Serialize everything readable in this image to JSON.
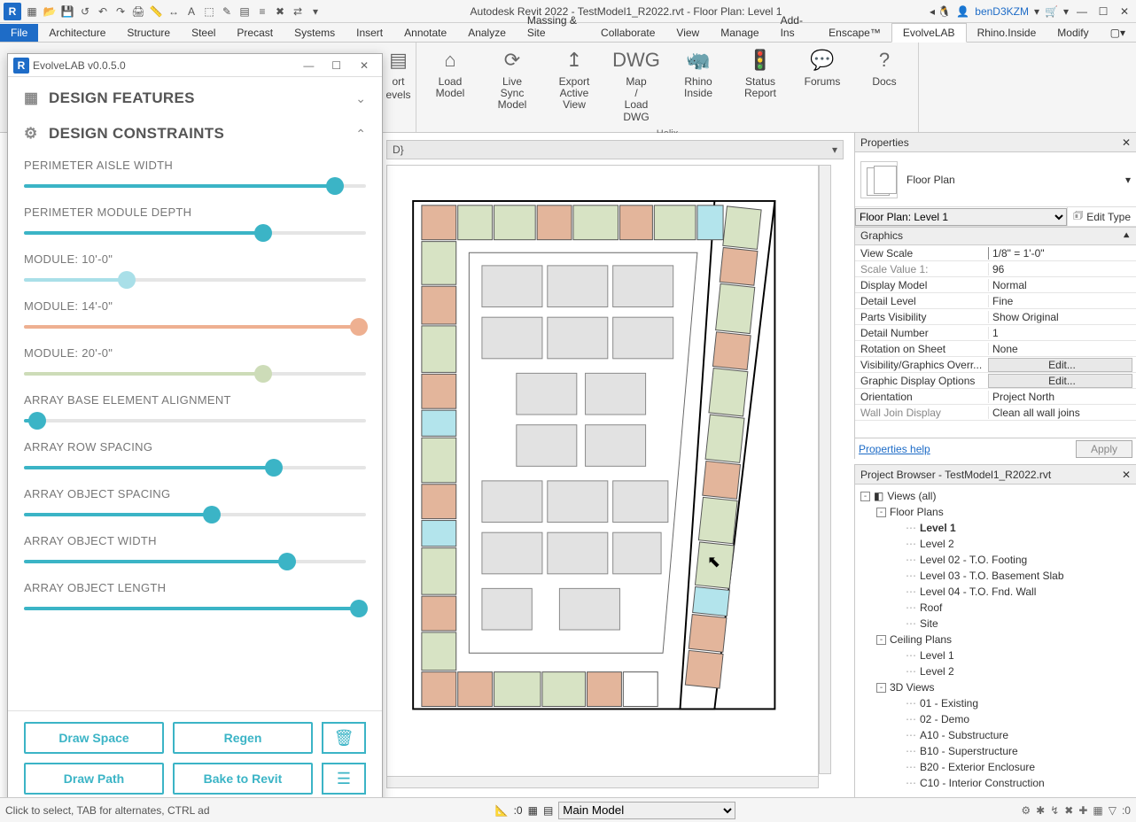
{
  "titlebar": {
    "title": "Autodesk Revit 2022 - TestModel1_R2022.rvt - Floor Plan: Level 1",
    "user": "benD3KZM",
    "search_icon": "🔍"
  },
  "menutabs": [
    "File",
    "Architecture",
    "Structure",
    "Steel",
    "Precast",
    "Systems",
    "Insert",
    "Annotate",
    "Analyze",
    "Massing & Site",
    "Collaborate",
    "View",
    "Manage",
    "Add-Ins",
    "Enscape™",
    "EvolveLAB",
    "Rhino.Inside",
    "Modify"
  ],
  "selected_tab": "EvolveLAB",
  "ribbon": {
    "helix_label": "Helix",
    "btn_levels": "evels",
    "btn_ort": "ort",
    "buttons": [
      {
        "label": "Load Model",
        "icon": "⌂"
      },
      {
        "label": "Live Sync Model",
        "icon": "⟳"
      },
      {
        "label": "Export Active View",
        "icon": "↥"
      },
      {
        "label": "Map / Load DWG",
        "icon": "DWG"
      },
      {
        "label": "Rhino Inside",
        "icon": "🦏"
      },
      {
        "label": "Status Report",
        "icon": "🚦"
      },
      {
        "label": "Forums",
        "icon": "💬"
      },
      {
        "label": "Docs",
        "icon": "?"
      }
    ]
  },
  "breadcrumb": "D}",
  "properties": {
    "title": "Properties",
    "type_name": "Floor Plan",
    "instance_sel": "Floor Plan: Level 1",
    "edit_type": "Edit Type",
    "group": "Graphics",
    "rows": [
      {
        "k": "View Scale",
        "v": "1/8\" = 1'-0\"",
        "bold": true
      },
      {
        "k": "Scale Value    1:",
        "v": "96",
        "dim": true
      },
      {
        "k": "Display Model",
        "v": "Normal"
      },
      {
        "k": "Detail Level",
        "v": "Fine"
      },
      {
        "k": "Parts Visibility",
        "v": "Show Original"
      },
      {
        "k": "Detail Number",
        "v": "1"
      },
      {
        "k": "Rotation on Sheet",
        "v": "None"
      },
      {
        "k": "Visibility/Graphics Overr...",
        "v": "Edit...",
        "btn": true
      },
      {
        "k": "Graphic Display Options",
        "v": "Edit...",
        "btn": true
      },
      {
        "k": "Orientation",
        "v": "Project North"
      },
      {
        "k": "Wall Join Display",
        "v": "Clean all wall joins",
        "dim": true
      }
    ],
    "help": "Properties help",
    "apply": "Apply"
  },
  "project_browser": {
    "title": "Project Browser - TestModel1_R2022.rvt",
    "tree": [
      {
        "d": 0,
        "tw": "-",
        "label": "Views (all)",
        "icon": "◧"
      },
      {
        "d": 1,
        "tw": "-",
        "label": "Floor Plans"
      },
      {
        "d": 2,
        "label": "Level 1",
        "bold": true
      },
      {
        "d": 2,
        "label": "Level 2"
      },
      {
        "d": 2,
        "label": "Level 02 - T.O. Footing"
      },
      {
        "d": 2,
        "label": "Level 03 - T.O. Basement Slab"
      },
      {
        "d": 2,
        "label": "Level 04 - T.O. Fnd. Wall"
      },
      {
        "d": 2,
        "label": "Roof"
      },
      {
        "d": 2,
        "label": "Site"
      },
      {
        "d": 1,
        "tw": "-",
        "label": "Ceiling Plans"
      },
      {
        "d": 2,
        "label": "Level 1"
      },
      {
        "d": 2,
        "label": "Level 2"
      },
      {
        "d": 1,
        "tw": "-",
        "label": "3D Views"
      },
      {
        "d": 2,
        "label": "01 - Existing"
      },
      {
        "d": 2,
        "label": "02 - Demo"
      },
      {
        "d": 2,
        "label": "A10 - Substructure"
      },
      {
        "d": 2,
        "label": "B10 - Superstructure"
      },
      {
        "d": 2,
        "label": "B20 - Exterior Enclosure"
      },
      {
        "d": 2,
        "label": "C10 - Interior Construction"
      }
    ]
  },
  "evolvelab": {
    "wintitle": "EvolveLAB v0.0.5.0",
    "section_features": "DESIGN FEATURES",
    "section_constraints": "DESIGN CONSTRAINTS",
    "sliders": [
      {
        "label": "PERIMETER AISLE WIDTH",
        "pos": 91,
        "color": "#3bb4c6"
      },
      {
        "label": "PERIMETER MODULE DEPTH",
        "pos": 70,
        "color": "#3bb4c6"
      },
      {
        "label": "MODULE: 10'-0\"",
        "pos": 30,
        "color": "#a9dfe8"
      },
      {
        "label": "MODULE: 14'-0\"",
        "pos": 98,
        "color": "#eeb091"
      },
      {
        "label": "MODULE: 20'-0\"",
        "pos": 70,
        "color": "#cddcb8"
      },
      {
        "label": "ARRAY BASE ELEMENT ALIGNMENT",
        "pos": 4,
        "color": "#3bb4c6"
      },
      {
        "label": "ARRAY ROW SPACING",
        "pos": 73,
        "color": "#3bb4c6"
      },
      {
        "label": "ARRAY OBJECT SPACING",
        "pos": 55,
        "color": "#3bb4c6"
      },
      {
        "label": "ARRAY OBJECT WIDTH",
        "pos": 77,
        "color": "#3bb4c6"
      },
      {
        "label": "ARRAY OBJECT LENGTH",
        "pos": 98,
        "color": "#3bb4c6"
      }
    ],
    "btn_drawspace": "Draw Space",
    "btn_regen": "Regen",
    "btn_drawpath": "Draw Path",
    "btn_bake": "Bake to Revit"
  },
  "statusbar": {
    "hint": "Click to select, TAB for alternates, CTRL ad",
    "scale": ":0",
    "mainmodel": "Main Model",
    "filtercount": ":0"
  }
}
